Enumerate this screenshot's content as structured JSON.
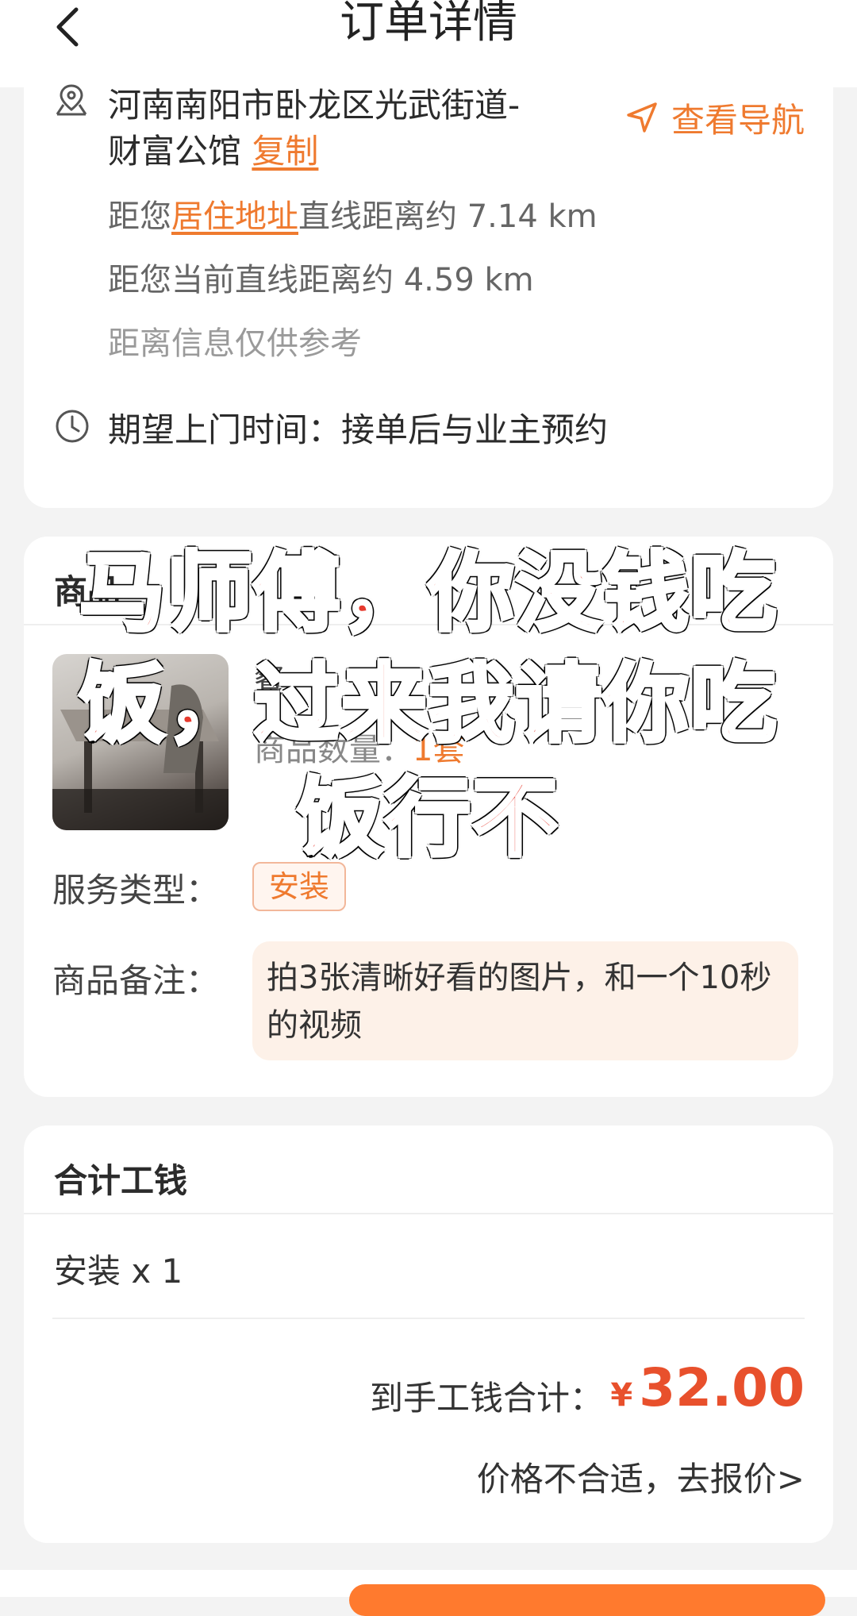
{
  "header": {
    "title": "订单详情",
    "back_icon": "chevron-left-icon"
  },
  "address": {
    "text": "河南南阳市卧龙区光武街道-财富公馆",
    "copy_label": "复制",
    "nav_label": "查看导航",
    "distance_home_prefix": "距您",
    "distance_home_link": "居住地址",
    "distance_home_suffix": "直线距离约 7.14 km",
    "distance_current": "距您当前直线距离约 4.59 km",
    "distance_note": "距离信息仅供参考",
    "visit_time": "期望上门时间：接单后与业主预约"
  },
  "product": {
    "section_title": "商品",
    "name": "餐",
    "qty_label": "商品数量：",
    "qty_value": "1套",
    "service_type_label": "服务类型：",
    "service_type_value": "安装",
    "remark_label": "商品备注：",
    "remark_text": "拍3张清晰好看的图片，和一个10秒的视频"
  },
  "overlay": {
    "line1": "马师傅，你没钱吃",
    "line2": "饭，过来我请你吃",
    "line3": "饭行不"
  },
  "total": {
    "section_title": "合计工钱",
    "item": "安装 x 1",
    "total_label": "到手工钱合计：",
    "currency": "¥",
    "amount": "32.00",
    "quote_link": "价格不合适，去报价>"
  },
  "colors": {
    "accent": "#ef7a2f",
    "price": "#e8502c",
    "overlay_text": "#e63a2e"
  }
}
